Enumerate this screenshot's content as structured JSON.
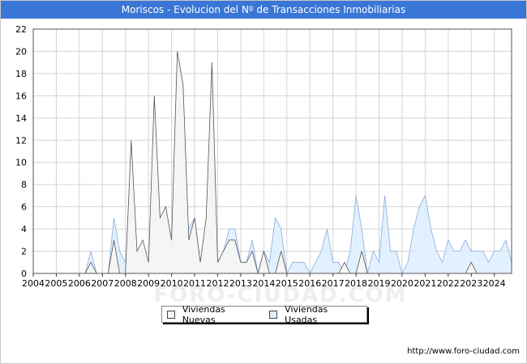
{
  "title": "Moriscos - Evolucion del Nº de Transacciones Inmobiliarias",
  "source_url": "http://www.foro-ciudad.com",
  "watermark": "FORO-CIUDAD.COM",
  "colors": {
    "title_bg": "#3a76d6",
    "nuevas_fill": "#f4f4f4",
    "nuevas_line": "#555555",
    "usadas_fill": "#ddeeff",
    "usadas_line": "#88aadd"
  },
  "chart_data": {
    "type": "area",
    "title": "Moriscos - Evolucion del Nº de Transacciones Inmobiliarias",
    "xlabel": "",
    "ylabel": "",
    "xlim": [
      2004,
      2024.75
    ],
    "ylim": [
      0,
      22
    ],
    "yticks": [
      0,
      2,
      4,
      6,
      8,
      10,
      12,
      14,
      16,
      18,
      20,
      22
    ],
    "xticks": [
      "2004",
      "2005",
      "2006",
      "2007",
      "2008",
      "2009",
      "2010",
      "2011",
      "2012",
      "2013",
      "2014",
      "2015",
      "2016",
      "2017",
      "2018",
      "2019",
      "2020",
      "2021",
      "2022",
      "2023",
      "2024"
    ],
    "grid": true,
    "legend_position": "bottom-center",
    "x": [
      2004.0,
      2004.25,
      2004.5,
      2004.75,
      2005.0,
      2005.25,
      2005.5,
      2005.75,
      2006.0,
      2006.25,
      2006.5,
      2006.75,
      2007.0,
      2007.25,
      2007.5,
      2007.75,
      2008.0,
      2008.25,
      2008.5,
      2008.75,
      2009.0,
      2009.25,
      2009.5,
      2009.75,
      2010.0,
      2010.25,
      2010.5,
      2010.75,
      2011.0,
      2011.25,
      2011.5,
      2011.75,
      2012.0,
      2012.25,
      2012.5,
      2012.75,
      2013.0,
      2013.25,
      2013.5,
      2013.75,
      2014.0,
      2014.25,
      2014.5,
      2014.75,
      2015.0,
      2015.25,
      2015.5,
      2015.75,
      2016.0,
      2016.25,
      2016.5,
      2016.75,
      2017.0,
      2017.25,
      2017.5,
      2017.75,
      2018.0,
      2018.25,
      2018.5,
      2018.75,
      2019.0,
      2019.25,
      2019.5,
      2019.75,
      2020.0,
      2020.25,
      2020.5,
      2020.75,
      2021.0,
      2021.25,
      2021.5,
      2021.75,
      2022.0,
      2022.25,
      2022.5,
      2022.75,
      2023.0,
      2023.25,
      2023.5,
      2023.75,
      2024.0,
      2024.25,
      2024.5,
      2024.75
    ],
    "series": [
      {
        "name": "Viviendas Nuevas",
        "values": [
          0,
          0,
          0,
          0,
          0,
          0,
          0,
          0,
          0,
          0,
          1,
          0,
          0,
          0,
          3,
          0,
          0,
          12,
          2,
          3,
          1,
          16,
          5,
          6,
          3,
          20,
          17,
          3,
          5,
          1,
          5,
          19,
          1,
          2,
          3,
          3,
          1,
          1,
          2,
          0,
          2,
          0,
          0,
          2,
          0,
          0,
          0,
          0,
          0,
          0,
          0,
          0,
          0,
          0,
          1,
          0,
          0,
          2,
          0,
          0,
          0,
          0,
          0,
          0,
          0,
          0,
          0,
          0,
          0,
          0,
          0,
          0,
          0,
          0,
          0,
          0,
          1,
          0,
          0,
          0,
          0,
          0,
          0,
          0
        ]
      },
      {
        "name": "Viviendas Usadas",
        "values": [
          0,
          0,
          0,
          0,
          0,
          0,
          0,
          0,
          0,
          0,
          2,
          0,
          0,
          0,
          5,
          2,
          1,
          3,
          2,
          2,
          1,
          2,
          4,
          6,
          2,
          6,
          3,
          4,
          5,
          1,
          4,
          8,
          1,
          2,
          4,
          4,
          1,
          1,
          3,
          0,
          2,
          1,
          5,
          4,
          0,
          1,
          1,
          1,
          0,
          1,
          2,
          4,
          1,
          1,
          0,
          2,
          7,
          4,
          0,
          2,
          1,
          7,
          2,
          2,
          0,
          1,
          4,
          6,
          7,
          4,
          2,
          1,
          3,
          2,
          2,
          3,
          2,
          2,
          2,
          1,
          2,
          2,
          3,
          1
        ]
      }
    ]
  }
}
